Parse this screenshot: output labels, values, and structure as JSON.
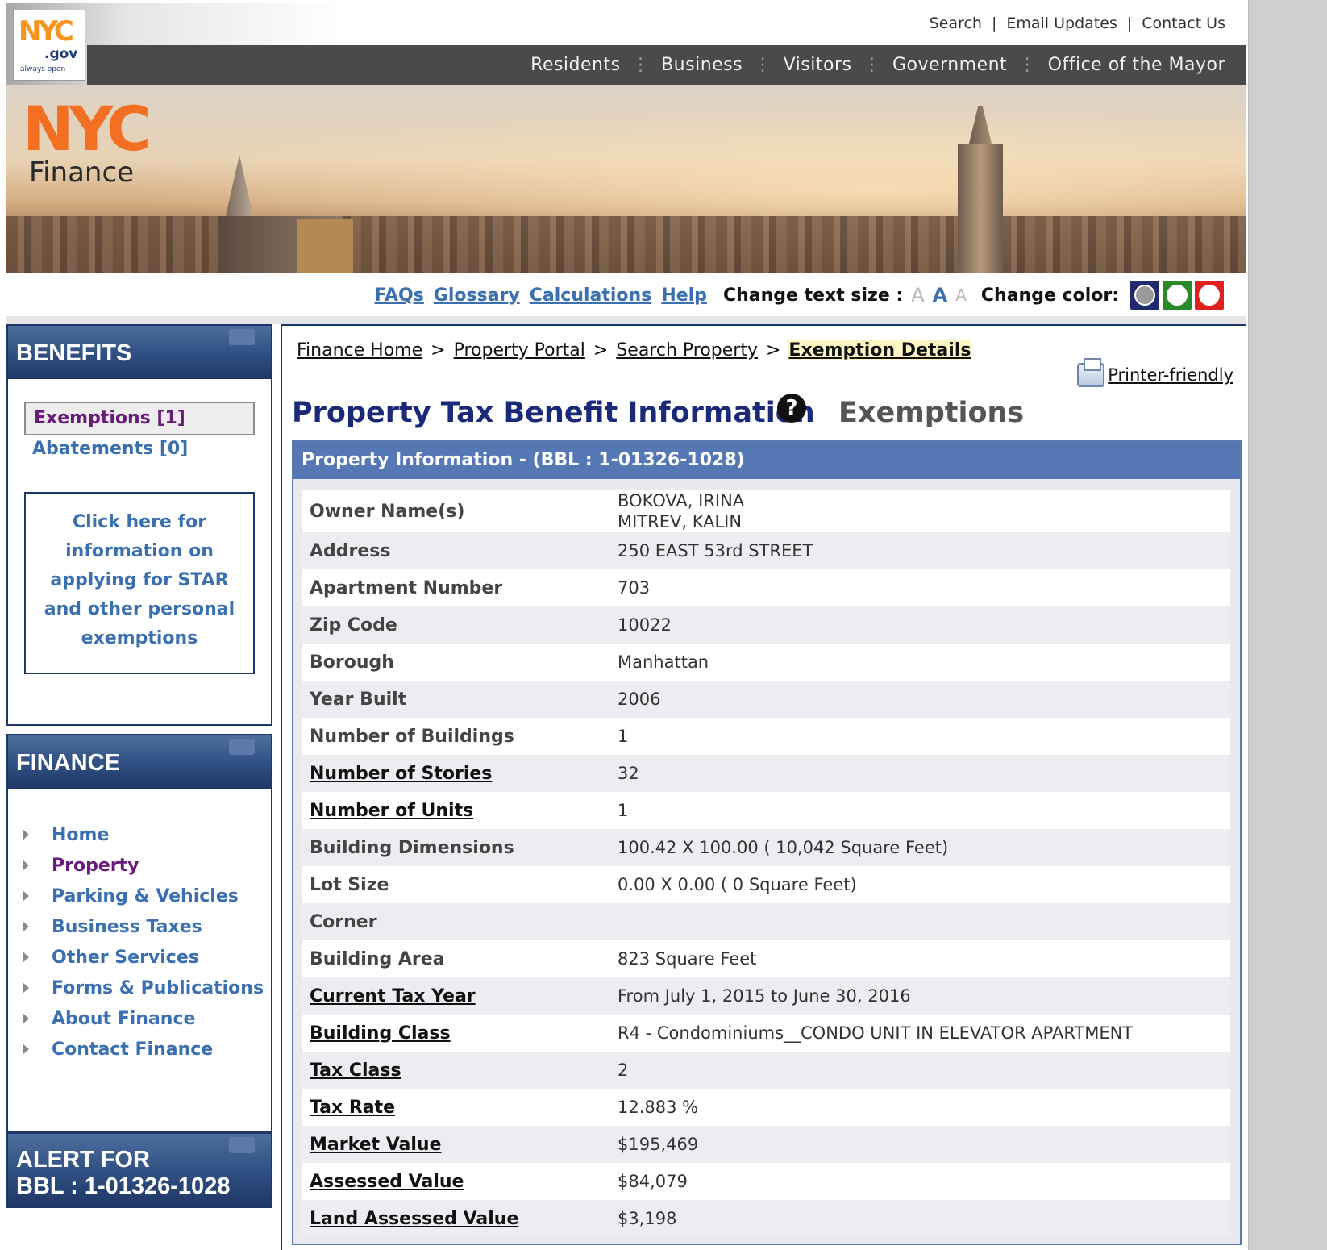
{
  "header": {
    "logo": {
      "nyc": "NYC",
      "gov": ".gov",
      "tagline": "always open"
    },
    "util_links": [
      "Search",
      "Email Updates",
      "Contact Us"
    ],
    "nav": [
      "Residents",
      "Business",
      "Visitors",
      "Government",
      "Office of the Mayor"
    ],
    "finance_logo": {
      "big": "NYC",
      "word": "Finance"
    }
  },
  "tools": {
    "links": [
      "FAQs",
      "Glossary",
      "Calculations",
      "Help"
    ],
    "text_size_label": "Change text size :",
    "text_size_options": [
      "A",
      "A",
      "A"
    ],
    "color_label": "Change color:",
    "colors": {
      "blue": "#202b6e",
      "green": "#2a8a2a",
      "red": "#e02020"
    }
  },
  "sidebar": {
    "benefits": {
      "title": "BENEFITS",
      "exemptions": "Exemptions [1]",
      "abatements": "Abatements [0]",
      "star_lines": [
        "Click here for",
        "information on",
        "applying for STAR",
        "and other personal",
        "exemptions"
      ]
    },
    "finance": {
      "title": "FINANCE",
      "items": [
        "Home",
        "Property",
        "Parking & Vehicles",
        "Business Taxes",
        "Other Services",
        "Forms & Publications",
        "About Finance",
        "Contact Finance"
      ],
      "active_index": 1
    },
    "alert": {
      "line1": "ALERT FOR",
      "line2": "BBL : 1-01326-1028"
    }
  },
  "main": {
    "breadcrumb": [
      "Finance Home",
      "Property Portal",
      "Search Property"
    ],
    "breadcrumb_current": "Exemption Details",
    "printer": "Printer-friendly",
    "title": "Property Tax Benefit Information",
    "help_glyph": "?",
    "subtitle": "Exemptions",
    "panel_header": "Property Information - (BBL : 1-01326-1028)",
    "rows": [
      {
        "label": "Owner Name(s)",
        "value": "BOKOVA, IRINA",
        "value2": "MITREV, KALIN",
        "link": false
      },
      {
        "label": "Address",
        "value": "250 EAST 53rd STREET",
        "link": false
      },
      {
        "label": "Apartment Number",
        "value": "703",
        "link": false
      },
      {
        "label": "Zip Code",
        "value": "10022",
        "link": false
      },
      {
        "label": "Borough",
        "value": "Manhattan",
        "link": false
      },
      {
        "label": "Year Built",
        "value": "2006",
        "link": false
      },
      {
        "label": "Number of Buildings",
        "value": "1",
        "link": false
      },
      {
        "label": "Number of Stories",
        "value": "32",
        "link": true
      },
      {
        "label": "Number of Units",
        "value": "1",
        "link": true
      },
      {
        "label": "Building Dimensions",
        "value": "100.42 X 100.00 ( 10,042 Square Feet)",
        "link": false
      },
      {
        "label": "Lot Size",
        "value": "0.00 X 0.00 ( 0 Square Feet)",
        "link": false
      },
      {
        "label": "Corner",
        "value": "",
        "link": false
      },
      {
        "label": "Building Area",
        "value": "823 Square Feet",
        "link": false
      },
      {
        "label": "Current Tax Year",
        "value": "From July 1, 2015 to June 30, 2016",
        "link": true
      },
      {
        "label": "Building Class",
        "value": "R4 - Condominiums__CONDO UNIT IN ELEVATOR APARTMENT",
        "link": true
      },
      {
        "label": "Tax Class",
        "value": "2",
        "link": true
      },
      {
        "label": "Tax Rate",
        "value": "12.883 %",
        "link": true
      },
      {
        "label": "Market Value",
        "value": "$195,469",
        "link": true
      },
      {
        "label": "Assessed Value",
        "value": "$84,079",
        "link": true
      },
      {
        "label": "Land Assessed Value",
        "value": "$3,198",
        "link": true
      }
    ]
  }
}
